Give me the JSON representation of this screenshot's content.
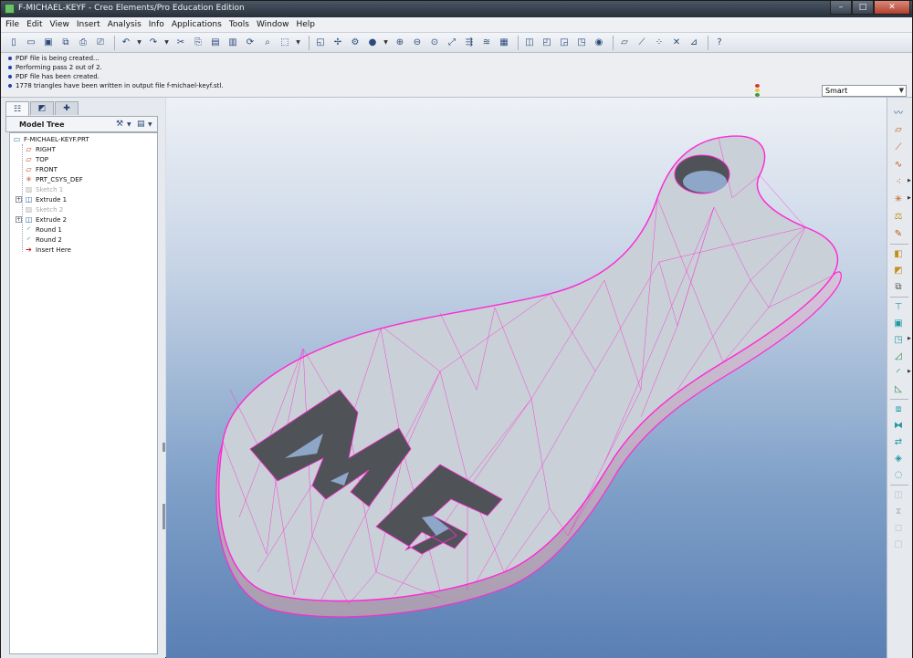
{
  "window": {
    "title": "F-MICHAEL-KEYF - Creo Elements/Pro Education Edition",
    "controls": {
      "minimize": "–",
      "maximize": "□",
      "close": "✕"
    }
  },
  "menu": [
    "File",
    "Edit",
    "View",
    "Insert",
    "Analysis",
    "Info",
    "Applications",
    "Tools",
    "Window",
    "Help"
  ],
  "messages": [
    "PDF file is being created...",
    "Performing pass 2 out of 2.",
    "PDF file has been created.",
    "1778 triangles have been written in output file f-michael-keyf.stl."
  ],
  "filter": {
    "value": "Smart"
  },
  "model_tree": {
    "title": "Model Tree",
    "items": [
      {
        "label": "F-MICHAEL-KEYF.PRT",
        "icon": "part-icon",
        "level": 0,
        "dim": false,
        "expandable": false
      },
      {
        "label": "RIGHT",
        "icon": "datum-plane-icon",
        "level": 1,
        "dim": false,
        "expandable": false
      },
      {
        "label": "TOP",
        "icon": "datum-plane-icon",
        "level": 1,
        "dim": false,
        "expandable": false
      },
      {
        "label": "FRONT",
        "icon": "datum-plane-icon",
        "level": 1,
        "dim": false,
        "expandable": false
      },
      {
        "label": "PRT_CSYS_DEF",
        "icon": "csys-icon",
        "level": 1,
        "dim": false,
        "expandable": false
      },
      {
        "label": "Sketch 1",
        "icon": "sketch-icon",
        "level": 1,
        "dim": true,
        "expandable": false
      },
      {
        "label": "Extrude 1",
        "icon": "extrude-icon",
        "level": 1,
        "dim": false,
        "expandable": true
      },
      {
        "label": "Sketch 2",
        "icon": "sketch-icon",
        "level": 1,
        "dim": true,
        "expandable": false
      },
      {
        "label": "Extrude 2",
        "icon": "extrude-icon",
        "level": 1,
        "dim": false,
        "expandable": true
      },
      {
        "label": "Round 1",
        "icon": "round-icon",
        "level": 1,
        "dim": false,
        "expandable": false
      },
      {
        "label": "Round 2",
        "icon": "round-icon",
        "level": 1,
        "dim": false,
        "expandable": false
      },
      {
        "label": "Insert Here",
        "icon": "insert-arrow-icon",
        "level": 1,
        "dim": false,
        "expandable": false
      }
    ]
  },
  "colors": {
    "mesh_edges": "#ff2ad4",
    "part_surface": "#c9d0d8",
    "part_dark": "#4f5257",
    "viewport_top": "#eef1f6",
    "viewport_bottom": "#5a7fb4"
  }
}
